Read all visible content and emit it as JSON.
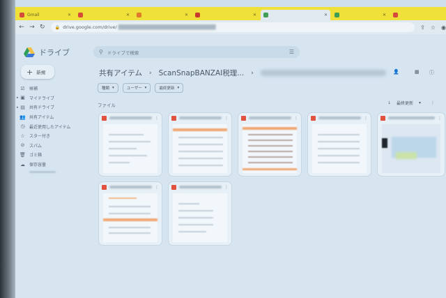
{
  "browser": {
    "tabs": [
      {
        "label": "Gmail",
        "color": "#d64a3a",
        "active": false
      },
      {
        "label": "",
        "color": "#d64a3a",
        "active": false
      },
      {
        "label": "",
        "color": "#e07a2b",
        "active": false
      },
      {
        "label": "",
        "color": "#c73b2f",
        "active": false
      },
      {
        "label": "",
        "color": "#3f9e55",
        "active": true
      },
      {
        "label": "",
        "color": "#3f9e55",
        "active": false
      },
      {
        "label": "",
        "color": "#d64a3a",
        "active": false
      }
    ],
    "url": "drive.google.com/drive/"
  },
  "app": {
    "logo_text": "ドライブ",
    "new_label": "新規",
    "search_placeholder": "ドライブで検索",
    "sidebar": [
      {
        "label": "候補",
        "icon": "suggested-icon"
      },
      {
        "label": "マイドライブ",
        "icon": "my-drive-icon"
      },
      {
        "label": "共有ドライブ",
        "icon": "shared-drive-icon"
      },
      {
        "label": "共有アイテム",
        "icon": "shared-icon"
      },
      {
        "label": "最近使用したアイテム",
        "icon": "clock-icon"
      },
      {
        "label": "スター付き",
        "icon": "star-icon"
      },
      {
        "label": "スパム",
        "icon": "spam-icon"
      },
      {
        "label": "ゴミ箱",
        "icon": "trash-icon"
      },
      {
        "label": "保存容量",
        "icon": "cloud-icon"
      }
    ],
    "breadcrumb": {
      "root": "共有アイテム",
      "folder": "ScanSnapBANZAI税理..."
    },
    "filters": [
      "種類",
      "ユーザー",
      "最終更新"
    ],
    "section_label": "ファイル",
    "sort_label": "最終更新"
  },
  "colors": {
    "accent": "#efe13a",
    "pdf": "#e0523d"
  }
}
